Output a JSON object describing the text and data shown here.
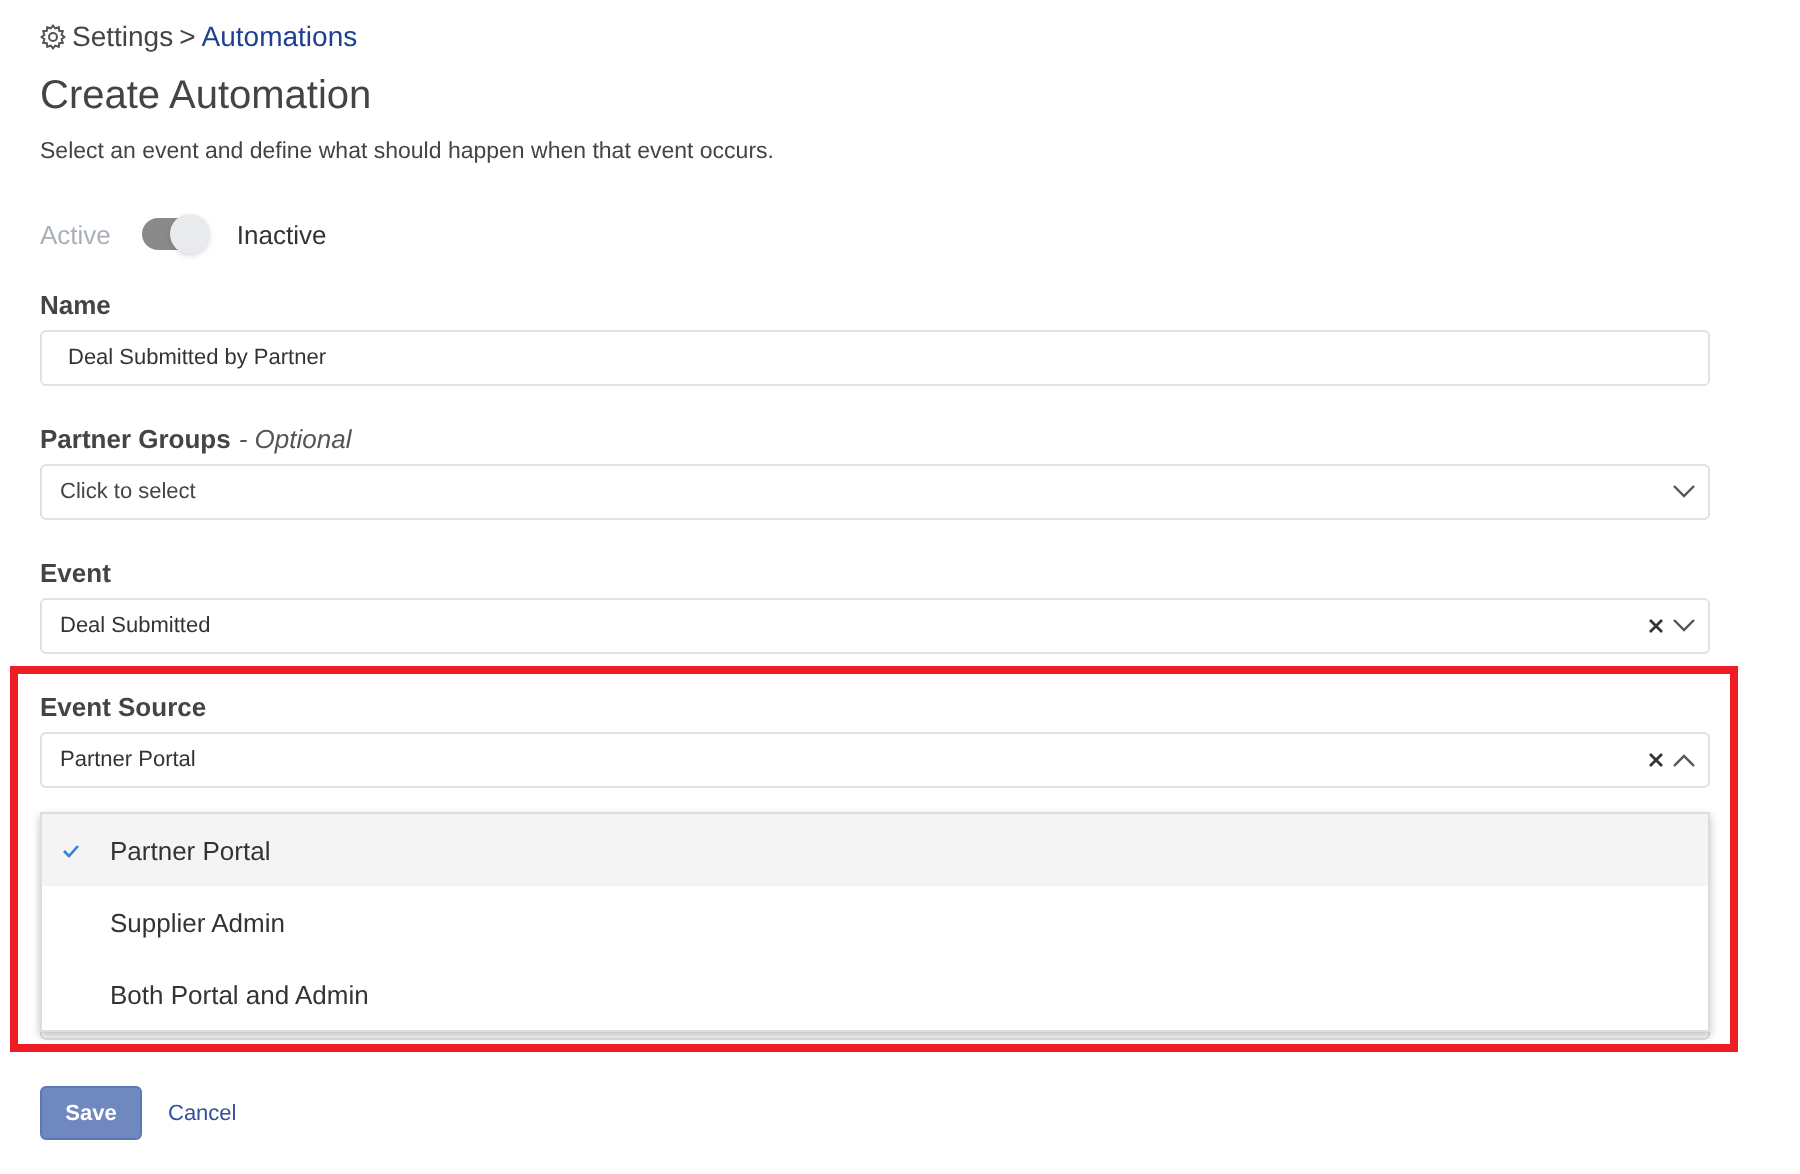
{
  "breadcrumb": {
    "parent": "Settings",
    "separator": ">",
    "current": "Automations"
  },
  "title": "Create Automation",
  "description": "Select an event and define what should happen when that event occurs.",
  "status_options": [
    {
      "label": "Active",
      "selected": false
    },
    {
      "label": "Inactive",
      "selected": true
    }
  ],
  "fields": [
    {
      "kind": "text",
      "label": "Name",
      "value": "Deal Submitted by Partner"
    },
    {
      "kind": "select",
      "label": "Partner Groups",
      "label_note": "- Optional",
      "placeholder": "Click to select",
      "clearable": false,
      "expanded": false
    },
    {
      "kind": "select",
      "label": "Event",
      "value": "Deal Submitted",
      "clearable": true,
      "expanded": false
    },
    {
      "kind": "select",
      "label": "Event Source",
      "value": "Partner Portal",
      "clearable": true,
      "expanded": true,
      "options": [
        {
          "label": "Partner Portal",
          "selected": true
        },
        {
          "label": "Supplier Admin",
          "selected": false
        },
        {
          "label": "Both Portal and Admin",
          "selected": false
        }
      ]
    }
  ],
  "buttons": {
    "save": "Save",
    "cancel": "Cancel"
  },
  "highlight": true
}
